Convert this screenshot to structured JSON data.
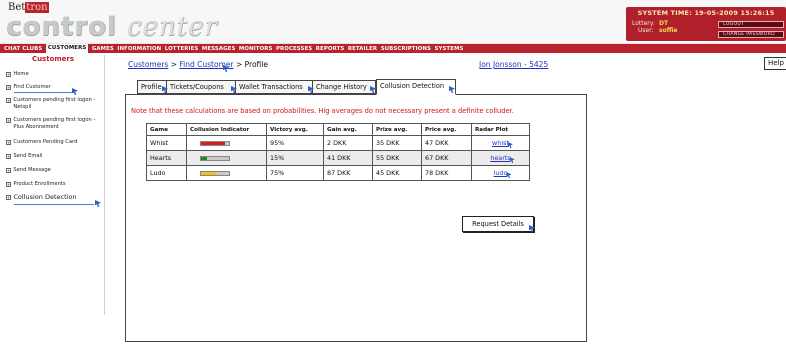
{
  "header": {
    "logo_small_prefix": "Bet",
    "logo_small_highlight": "tron",
    "logo_word1": "control",
    "logo_word2": "center",
    "system_time": "SYSTEM TIME: 19-05-2009 15:26:15",
    "lottery_label": "Lottery:",
    "lottery_value": "DT",
    "user_label": "User:",
    "user_value": "soffie",
    "logout_label": "LOGOUT",
    "change_password_label": "CHANGE PASSWORD",
    "accent_color": "#b8232c"
  },
  "main_nav": {
    "items": [
      "CHAT CLUBS",
      "CUSTOMERS",
      "GAMES",
      "INFORMATION",
      "LOTTERIES",
      "MESSAGES",
      "MONITORS",
      "PROCESSES",
      "REPORTS",
      "RETAILER",
      "SUBSCRIPTIONS",
      "SYSTEMS"
    ],
    "active_index": 1
  },
  "sidebar": {
    "title": "Customers",
    "items": [
      {
        "label": "Home"
      },
      {
        "label": "Find Customer"
      },
      {
        "label": "Customers pending first logon - Netspil"
      },
      {
        "label": "Customers pending first logon - Plus Abonnement"
      },
      {
        "label": "Customers Pending Card"
      },
      {
        "label": "Send Email"
      },
      {
        "label": "Send Message"
      },
      {
        "label": "Product Enrollments"
      },
      {
        "label": "Collusion Detection"
      }
    ]
  },
  "breadcrumb": {
    "crumb1": "Customers",
    "sep1": " > ",
    "crumb2": "Find Customer",
    "sep2": " > ",
    "crumb3": "Profile"
  },
  "customer_link": "Jon Jonsson - 5425",
  "help_label": "Help",
  "tabs": [
    "Profile",
    "Tickets/Coupons",
    "Wallet Transactions",
    "Change History",
    "Collusion Detection"
  ],
  "active_tab": "Collusion Detection",
  "note": "Note that these calculations are based on probabilities. Hig averages do not necessary present a definite colluder.",
  "table": {
    "headers": [
      "Game",
      "Collusion Indicator",
      "Victory avg.",
      "Gain avg.",
      "Prize avg.",
      "Price avg.",
      "Radar Plot"
    ],
    "rows": [
      {
        "game": "Whist",
        "indicator_level": 0.85,
        "indicator_color": "#d42020",
        "victory": "95%",
        "gain": "2 DKK",
        "prize": "35 DKK",
        "price": "47 DKK",
        "plot": "whist"
      },
      {
        "game": "Hearts",
        "indicator_level": 0.2,
        "indicator_color": "#1f8a1f",
        "victory": "15%",
        "gain": "41 DKK",
        "prize": "55 DKK",
        "price": "67 DKK",
        "plot": "hearts"
      },
      {
        "game": "Ludo",
        "indicator_level": 0.55,
        "indicator_color": "#f2c21b",
        "victory": "75%",
        "gain": "87 DKK",
        "prize": "45 DKK",
        "price": "78 DKK",
        "plot": "ludo"
      }
    ]
  },
  "request_button": "Request Details"
}
